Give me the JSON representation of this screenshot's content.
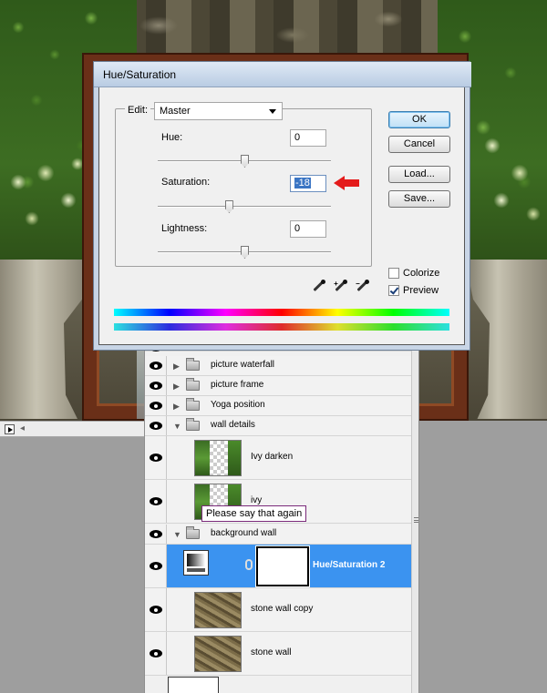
{
  "dialog": {
    "title": "Hue/Saturation",
    "edit_label": "Edit:",
    "edit_value": "Master",
    "hue": {
      "label": "Hue:",
      "value": "0",
      "slider_fraction": 0.5
    },
    "saturation": {
      "label": "Saturation:",
      "value": "-18",
      "slider_fraction": 0.41
    },
    "lightness": {
      "label": "Lightness:",
      "value": "0",
      "slider_fraction": 0.5
    },
    "buttons": {
      "ok": "OK",
      "cancel": "Cancel",
      "load": "Load...",
      "save": "Save..."
    },
    "colorize": {
      "label": "Colorize",
      "checked": false
    },
    "preview": {
      "label": "Preview",
      "checked": true
    },
    "eyedroppers": [
      "eyedropper-icon",
      "eyedropper-add-icon",
      "eyedropper-subtract-icon"
    ],
    "highlight_color": "#e41b1b"
  },
  "tooltip": "Please say that again",
  "layers": {
    "rows": [
      {
        "name": "picture waterfall",
        "kind": "group",
        "expanded": false
      },
      {
        "name": "picture frame",
        "kind": "group",
        "expanded": false
      },
      {
        "name": "Yoga position",
        "kind": "group",
        "expanded": false
      },
      {
        "name": "wall details",
        "kind": "group",
        "expanded": true
      },
      {
        "name": "Ivy darken",
        "kind": "layer"
      },
      {
        "name": "ivy",
        "kind": "layer"
      },
      {
        "name": "background wall",
        "kind": "group",
        "expanded": true
      },
      {
        "name": "Hue/Saturation 2",
        "kind": "adjustment",
        "selected": true
      },
      {
        "name": "stone wall copy",
        "kind": "layer"
      },
      {
        "name": "stone wall",
        "kind": "layer"
      }
    ],
    "selection_color": "#3b93f0"
  }
}
